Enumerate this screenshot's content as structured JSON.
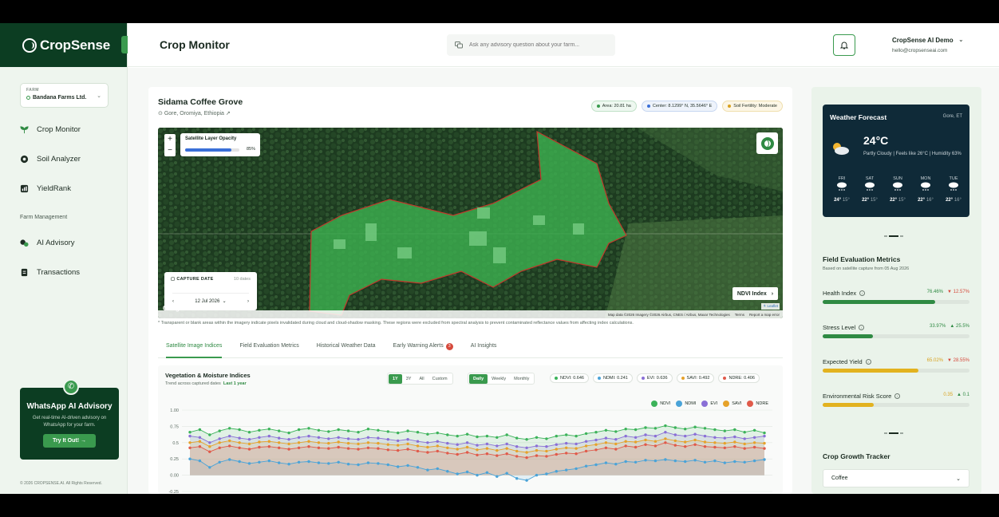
{
  "brand": {
    "name": "CropSense"
  },
  "sidebar": {
    "farm_caption": "FARM",
    "farm_name": "Bandana Farms Ltd.",
    "items": [
      {
        "label": "Crop Monitor",
        "icon": "sprout-icon"
      },
      {
        "label": "Soil Analyzer",
        "icon": "soil-icon"
      },
      {
        "label": "YieldRank",
        "icon": "rank-icon"
      }
    ],
    "section_label": "Farm Management",
    "items2": [
      {
        "label": "AI Advisory",
        "icon": "chat-icon"
      },
      {
        "label": "Transactions",
        "icon": "document-icon"
      }
    ],
    "whatsapp": {
      "title": "WhatsApp AI Advisory",
      "desc": "Get real-time AI-driven advisory on WhatsApp for your farm.",
      "button": "Try It Out! →"
    },
    "copyright": "© 2026 CROPSENSE.AI. All Rights Reserved."
  },
  "topbar": {
    "title": "Crop Monitor",
    "search_placeholder": "Ask any advisory question about your farm...",
    "user_name": "CropSense AI Demo",
    "user_email": "hello@cropsenseai.com"
  },
  "field": {
    "title": "Sidama Coffee Grove",
    "location": "Gore, Oromiya, Ethiopia",
    "chips": [
      {
        "label": "Area: 20.81 ha",
        "color": "#3a9a4e"
      },
      {
        "label": "Center: 8.1299° N, 35.5646° E",
        "color": "#3a6fd8"
      },
      {
        "label": "Soil Fertility: Moderate",
        "color": "#d9a21f"
      }
    ],
    "opacity_label": "Satellite Layer Opacity",
    "opacity_value": "85%",
    "opacity_fraction": 0.85,
    "capture_label": "CAPTURE DATE",
    "capture_count": "10 dates",
    "capture_date": "12 Jul 2026",
    "index_button": "NDVI Index",
    "google": "Google",
    "leaflet": "⚘ Leaflet",
    "attribution": [
      "Map data ©2026 Imagery ©2026 Airbus, CNES / Airbus, Maxar Technologies",
      "Terms",
      "Report a map error"
    ],
    "mask_note": "* Transparent or blank areas within the imagery indicate pixels invalidated during cloud and cloud-shadow masking. These regions were excluded from spectral analysis to prevent contaminated reflectance values from affecting index calculations."
  },
  "tabs": [
    {
      "label": "Satellite Image Indices",
      "active": true
    },
    {
      "label": "Field Evaluation Metrics"
    },
    {
      "label": "Historical Weather Data"
    },
    {
      "label": "Early Warning Alerts",
      "badge": "3"
    },
    {
      "label": "AI Insights"
    }
  ],
  "chart_header": {
    "title": "Vegetation & Moisture Indices",
    "subtitle": "Trend across captured dates",
    "subtitle_link": "Last 1 year",
    "range_options": [
      "1Y",
      "3Y",
      "All",
      "Custom"
    ],
    "freq_options": [
      "Daily",
      "Weekly",
      "Monthly"
    ],
    "index_chips": [
      {
        "label": "NDVI: 0.646",
        "color": "#3cb35a"
      },
      {
        "label": "NDMI: 0.241",
        "color": "#4aa3d8"
      },
      {
        "label": "EVI: 0.636",
        "color": "#8a6fd6"
      },
      {
        "label": "SAVI: 0.492",
        "color": "#e6a22a"
      },
      {
        "label": "NDRE: 0.406",
        "color": "#e05a4a"
      }
    ]
  },
  "chart_data": {
    "type": "line",
    "yticks": [
      "1.00",
      "0.75",
      "0.5",
      "0.25",
      "0.00",
      "-0.25"
    ],
    "ylim": [
      -0.25,
      1.0
    ],
    "legend_position": "top-right",
    "series": [
      {
        "name": "NDVI",
        "color": "#3cb35a",
        "values": [
          0.66,
          0.7,
          0.62,
          0.68,
          0.72,
          0.7,
          0.66,
          0.69,
          0.71,
          0.68,
          0.65,
          0.7,
          0.72,
          0.69,
          0.67,
          0.7,
          0.68,
          0.66,
          0.71,
          0.69,
          0.67,
          0.65,
          0.68,
          0.66,
          0.63,
          0.65,
          0.62,
          0.6,
          0.63,
          0.59,
          0.6,
          0.58,
          0.62,
          0.57,
          0.55,
          0.58,
          0.56,
          0.6,
          0.62,
          0.6,
          0.64,
          0.66,
          0.69,
          0.67,
          0.71,
          0.7,
          0.73,
          0.72,
          0.76,
          0.73,
          0.71,
          0.74,
          0.72,
          0.7,
          0.68,
          0.7,
          0.66,
          0.69,
          0.65
        ]
      },
      {
        "name": "NDMI",
        "color": "#4aa3d8",
        "values": [
          0.25,
          0.22,
          0.12,
          0.2,
          0.24,
          0.21,
          0.18,
          0.2,
          0.22,
          0.19,
          0.17,
          0.2,
          0.21,
          0.19,
          0.18,
          0.2,
          0.17,
          0.16,
          0.19,
          0.18,
          0.16,
          0.13,
          0.15,
          0.12,
          0.08,
          0.1,
          0.06,
          0.02,
          0.05,
          0.0,
          0.04,
          -0.02,
          0.03,
          -0.05,
          -0.08,
          0.0,
          0.02,
          0.06,
          0.08,
          0.1,
          0.14,
          0.16,
          0.19,
          0.17,
          0.21,
          0.2,
          0.23,
          0.22,
          0.24,
          0.22,
          0.21,
          0.23,
          0.2,
          0.22,
          0.19,
          0.21,
          0.2,
          0.22,
          0.24
        ]
      },
      {
        "name": "EVI",
        "color": "#8a6fd6",
        "values": [
          0.6,
          0.58,
          0.5,
          0.56,
          0.6,
          0.57,
          0.55,
          0.58,
          0.6,
          0.57,
          0.55,
          0.58,
          0.6,
          0.58,
          0.56,
          0.58,
          0.56,
          0.55,
          0.58,
          0.57,
          0.55,
          0.53,
          0.55,
          0.52,
          0.5,
          0.52,
          0.49,
          0.47,
          0.5,
          0.46,
          0.48,
          0.45,
          0.48,
          0.44,
          0.42,
          0.45,
          0.44,
          0.47,
          0.49,
          0.48,
          0.52,
          0.54,
          0.57,
          0.55,
          0.6,
          0.58,
          0.62,
          0.6,
          0.66,
          0.62,
          0.6,
          0.63,
          0.6,
          0.58,
          0.57,
          0.59,
          0.56,
          0.58,
          0.6
        ]
      },
      {
        "name": "SAVI",
        "color": "#e6a22a",
        "values": [
          0.5,
          0.52,
          0.44,
          0.5,
          0.53,
          0.5,
          0.48,
          0.51,
          0.52,
          0.5,
          0.48,
          0.5,
          0.52,
          0.5,
          0.49,
          0.51,
          0.49,
          0.48,
          0.5,
          0.49,
          0.47,
          0.46,
          0.48,
          0.45,
          0.43,
          0.45,
          0.42,
          0.4,
          0.43,
          0.39,
          0.41,
          0.38,
          0.41,
          0.37,
          0.35,
          0.38,
          0.37,
          0.4,
          0.42,
          0.41,
          0.45,
          0.47,
          0.5,
          0.48,
          0.52,
          0.51,
          0.54,
          0.52,
          0.56,
          0.53,
          0.51,
          0.54,
          0.51,
          0.5,
          0.49,
          0.51,
          0.48,
          0.5,
          0.49
        ]
      },
      {
        "name": "NDRE",
        "color": "#e05a4a",
        "values": [
          0.42,
          0.44,
          0.36,
          0.42,
          0.45,
          0.42,
          0.4,
          0.43,
          0.44,
          0.42,
          0.4,
          0.42,
          0.44,
          0.42,
          0.41,
          0.43,
          0.41,
          0.4,
          0.42,
          0.41,
          0.39,
          0.38,
          0.4,
          0.37,
          0.35,
          0.37,
          0.34,
          0.32,
          0.35,
          0.31,
          0.33,
          0.3,
          0.33,
          0.29,
          0.27,
          0.3,
          0.29,
          0.32,
          0.34,
          0.33,
          0.37,
          0.39,
          0.42,
          0.4,
          0.45,
          0.43,
          0.47,
          0.45,
          0.5,
          0.46,
          0.44,
          0.47,
          0.44,
          0.43,
          0.42,
          0.44,
          0.41,
          0.43,
          0.41
        ]
      }
    ]
  },
  "weather": {
    "title": "Weather Forecast",
    "location": "Gore, ET",
    "temp": "24°C",
    "desc": "Partly Cloudy | Feels like 26°C | Humidity 63%",
    "days": [
      {
        "name": "FRI",
        "hi": "24°",
        "lo": "15°"
      },
      {
        "name": "SAT",
        "hi": "22°",
        "lo": "15°"
      },
      {
        "name": "SUN",
        "hi": "22°",
        "lo": "15°"
      },
      {
        "name": "MON",
        "hi": "22°",
        "lo": "16°"
      },
      {
        "name": "TUE",
        "hi": "22°",
        "lo": "16°"
      }
    ]
  },
  "metrics": {
    "title": "Field Evaluation Metrics",
    "subtitle": "Based on satellite capture from 05 Aug 2026",
    "items": [
      {
        "name": "Health Index",
        "value": "76.46%",
        "delta": "▼ 12.57%",
        "delta_color": "#d64a3c",
        "value_color": "#2f8a43",
        "fill": 0.7646,
        "bar_color": "#2f8a43"
      },
      {
        "name": "Stress Level",
        "value": "33.97%",
        "delta": "▲ 25.5%",
        "delta_color": "#2f8a43",
        "value_color": "#2f8a43",
        "fill": 0.3397,
        "bar_color": "#2f8a43"
      },
      {
        "name": "Expected Yield",
        "value": "65.02%",
        "delta": "▼ 28.55%",
        "delta_color": "#d64a3c",
        "value_color": "#d9a21f",
        "fill": 0.6502,
        "bar_color": "#e2b21f"
      },
      {
        "name": "Environmental Risk Score",
        "value": "0.35",
        "delta": "▲ 0.1",
        "delta_color": "#2f8a43",
        "value_color": "#d9a21f",
        "fill": 0.35,
        "bar_color": "#e2b21f"
      }
    ]
  },
  "growth": {
    "title": "Crop Growth Tracker",
    "selected": "Coffee"
  }
}
